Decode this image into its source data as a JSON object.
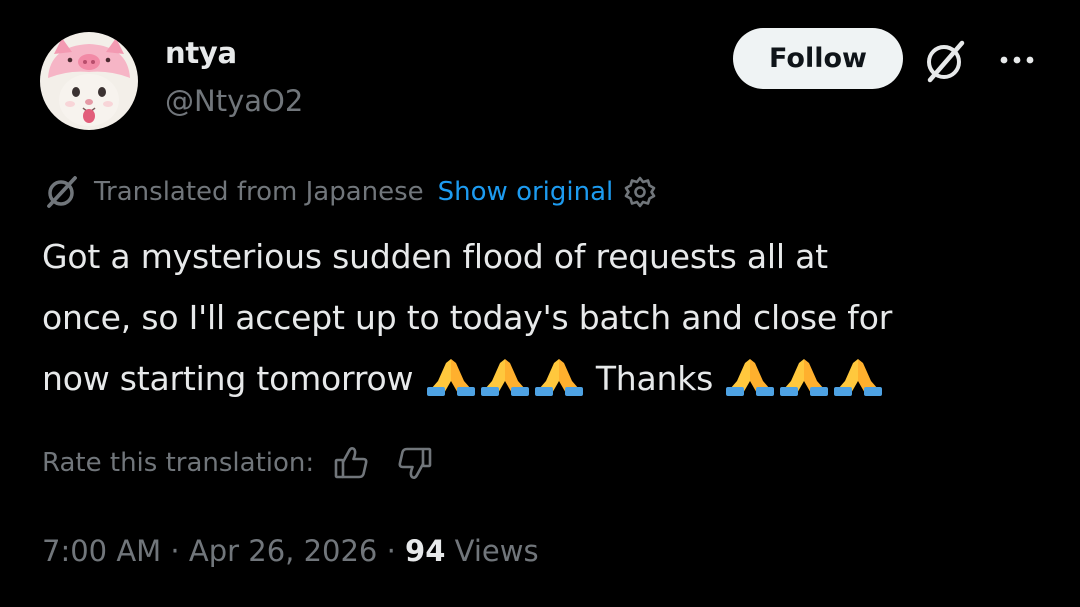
{
  "author": {
    "display_name": "ntya",
    "handle": "@NtyaO2"
  },
  "header": {
    "follow_label": "Follow",
    "grok_icon": "grok-icon",
    "more_icon": "more-icon"
  },
  "translation": {
    "notice": "Translated from Japanese",
    "show_original": "Show original",
    "settings_icon": "gear-icon"
  },
  "tweet": {
    "line1": "Got a mysterious sudden flood of requests all at",
    "line2": "once, so I'll accept up to today's batch and close for",
    "line3_before": "now starting tomorrow ",
    "thanks": " Thanks ",
    "emoji": "🙏"
  },
  "rating": {
    "label": "Rate this translation:",
    "up_icon": "thumbs-up-icon",
    "down_icon": "thumbs-down-icon"
  },
  "meta": {
    "time": "7:00 AM",
    "separator": " · ",
    "date": "Apr 26, 2026",
    "views_count": "94",
    "views_label": " Views"
  },
  "colors": {
    "background": "#000000",
    "text_primary": "#e7e9ea",
    "text_secondary": "#71767b",
    "link": "#1d9bf0",
    "button_bg": "#eff3f4",
    "button_text": "#0f1419",
    "avatar_pink": "#f4b6c6"
  }
}
